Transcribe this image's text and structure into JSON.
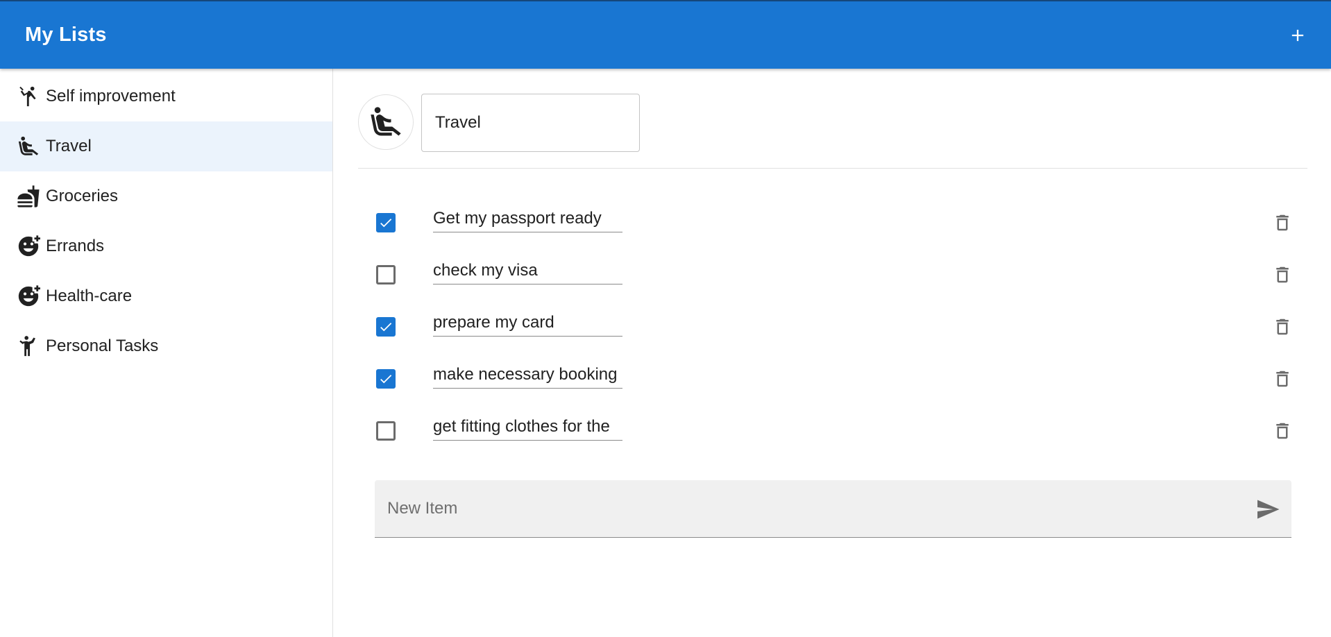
{
  "appbar": {
    "title": "My Lists",
    "add_icon": "plus-icon",
    "color": "#1976d2"
  },
  "sidebar": {
    "items": [
      {
        "label": "Self improvement",
        "icon": "sports-kabaddi-icon",
        "active": false
      },
      {
        "label": "Travel",
        "icon": "airline-seat-icon",
        "active": true
      },
      {
        "label": "Groceries",
        "icon": "fastfood-icon",
        "active": false
      },
      {
        "label": "Errands",
        "icon": "add-reaction-icon",
        "active": false
      },
      {
        "label": "Health-care",
        "icon": "add-reaction-icon",
        "active": false
      },
      {
        "label": "Personal Tasks",
        "icon": "person-walking-icon",
        "active": false
      }
    ]
  },
  "list": {
    "icon": "airline-seat-icon",
    "name": "Travel",
    "items": [
      {
        "text": "Get my passport ready",
        "checked": true
      },
      {
        "text": "check my visa",
        "checked": false
      },
      {
        "text": "prepare my card",
        "checked": true
      },
      {
        "text": "make necessary booking",
        "checked": true
      },
      {
        "text": "get fitting clothes for the",
        "checked": false
      }
    ],
    "new_item_placeholder": "New Item",
    "send_icon": "send-icon",
    "delete_icon": "delete-icon"
  }
}
